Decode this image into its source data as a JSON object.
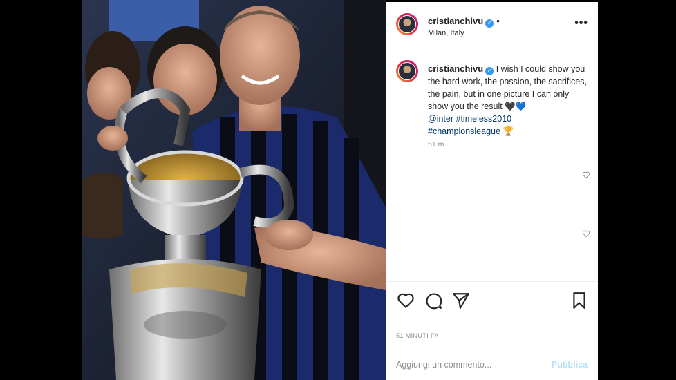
{
  "post": {
    "username": "cristianchivu",
    "location": "Milan, Italy",
    "more_icon": "•••",
    "follow_dot": "•",
    "caption_text": "I wish I could show you the hard work, the passion, the sacrifices, the pain, but in one picture I can only show you the result 🖤💙",
    "mention": "@inter",
    "hashtag1": "#timeless2010",
    "hashtag2": "#championsleague",
    "trophy_emoji": "🏆",
    "caption_time": "51 m",
    "timestamp": "51 MINUTI FA",
    "comment_placeholder": "Aggiungi un commento...",
    "publish_label": "Pubblica"
  },
  "icons": {
    "verified": "✓",
    "like": "heart-icon",
    "comment": "comment-icon",
    "share": "share-icon",
    "save": "bookmark-icon"
  },
  "colors": {
    "link": "#00376b",
    "verified": "#3897f0",
    "publish": "#b2dffc",
    "muted": "#8e8e8e"
  }
}
